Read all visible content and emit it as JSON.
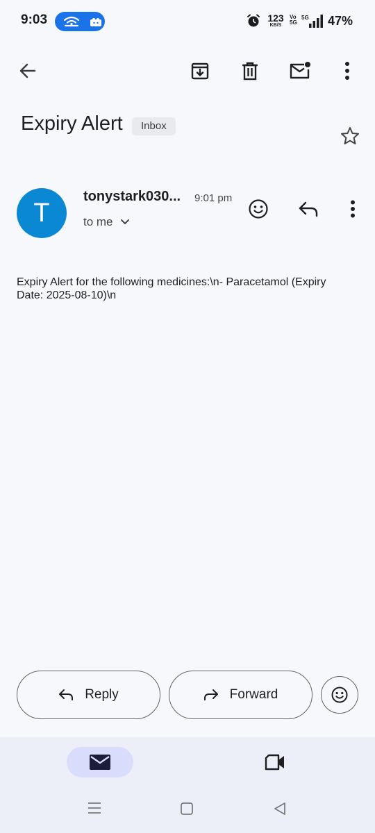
{
  "status_bar": {
    "time": "9:03",
    "net_speed_value": "123",
    "net_speed_unit": "KB/S",
    "volte_top": "Vo",
    "volte_bottom": "5G",
    "network_type": "5G",
    "battery": "47%",
    "icons": [
      "hotspot-icon",
      "cloud-icon",
      "alarm-icon",
      "signal-icon"
    ]
  },
  "toolbar": {
    "back_icon": "arrow-left-icon",
    "archive_icon": "archive-icon",
    "delete_icon": "trash-icon",
    "mark_unread_icon": "mail-unread-icon",
    "more_icon": "more-vertical-icon"
  },
  "email": {
    "subject": "Expiry Alert",
    "label": "Inbox",
    "sender_initial": "T",
    "sender_name": "tonystark030...",
    "time": "9:01 pm",
    "recipient": "to me",
    "body": "Expiry Alert for the following medicines:\\n- Paracetamol (Expiry Date: 2025-08-10)\\n"
  },
  "actions": {
    "reply_label": "Reply",
    "forward_label": "Forward"
  },
  "colors": {
    "background": "#f7f8fc",
    "avatar": "#0b88d4",
    "hotspot_pill": "#1a73e8",
    "nav_active": "#d9ddfb",
    "bottom_nav": "#eceef8"
  }
}
